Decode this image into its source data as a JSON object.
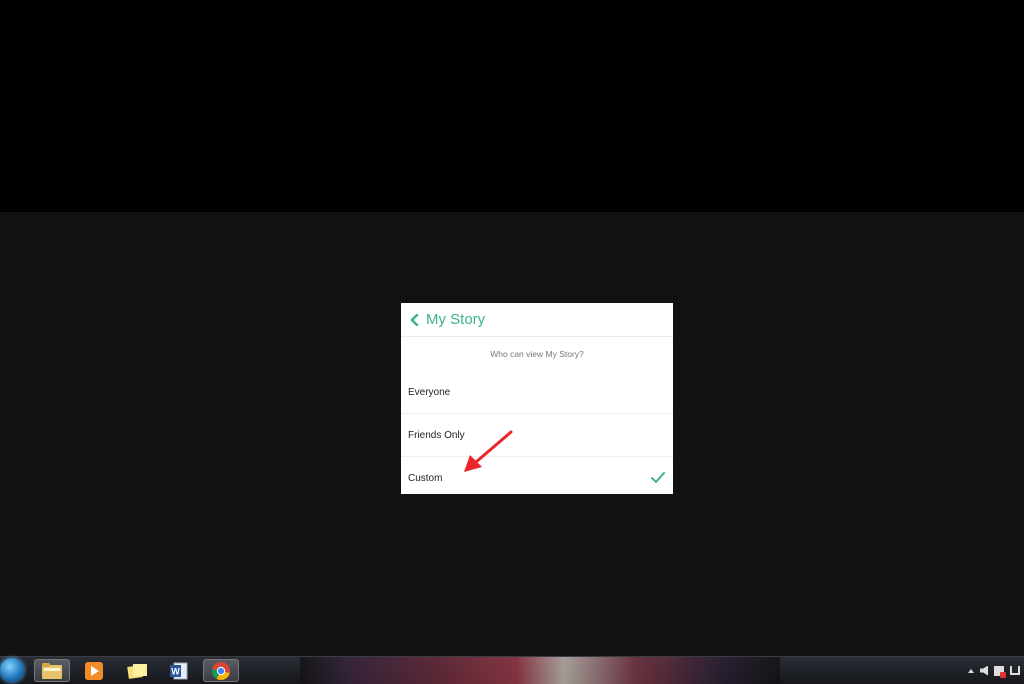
{
  "panel": {
    "title": "My Story",
    "question": "Who can view My Story?",
    "options": [
      {
        "label": "Everyone",
        "selected": false
      },
      {
        "label": "Friends Only",
        "selected": false
      },
      {
        "label": "Custom",
        "selected": true
      }
    ]
  },
  "colors": {
    "accent": "#3eb489",
    "arrow": "#e8262b",
    "app_background": "#111111"
  },
  "taskbar": {
    "pinned": [
      "file-explorer-icon",
      "media-player-icon",
      "sticky-notes-icon",
      "word-icon",
      "chrome-icon"
    ],
    "active": "chrome-icon"
  }
}
